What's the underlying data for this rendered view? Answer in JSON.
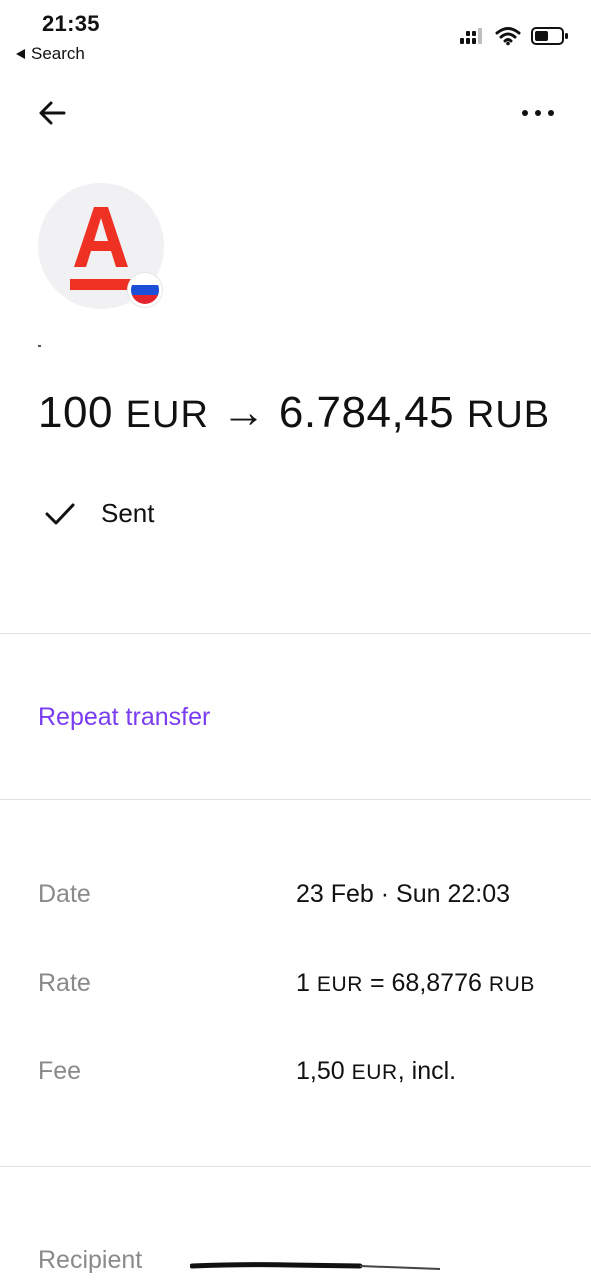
{
  "status_bar": {
    "time": "21:35",
    "back_app": "Search"
  },
  "transfer": {
    "amount_source": "100",
    "currency_source": "EUR",
    "arrow": "→",
    "amount_target": "6.784,45",
    "currency_target": "RUB",
    "status": "Sent"
  },
  "actions": {
    "repeat_transfer": "Repeat transfer"
  },
  "details": {
    "date_label": "Date",
    "date_value": "23 Feb · Sun 22:03",
    "rate_label": "Rate",
    "rate_lhs": "1",
    "rate_cur_from": "EUR",
    "rate_eq": "=",
    "rate_value": "68,8776",
    "rate_cur_to": "RUB",
    "fee_label": "Fee",
    "fee_amount": "1,50",
    "fee_cur": "EUR",
    "fee_suffix": ", incl.",
    "recipient_label": "Recipient"
  },
  "colors": {
    "accent": "#7a3cf0",
    "logo_red": "#ef3124",
    "muted": "#8a8a8a",
    "flag_white": "#ffffff",
    "flag_blue": "#1c4fd8",
    "flag_red": "#e3262e"
  },
  "icons": {
    "back": "arrow-left-icon",
    "more": "more-horizontal-icon",
    "status": "checkmark-icon",
    "bank_logo": "alfa-bank-logo",
    "country_flag": "russia-flag-icon"
  }
}
